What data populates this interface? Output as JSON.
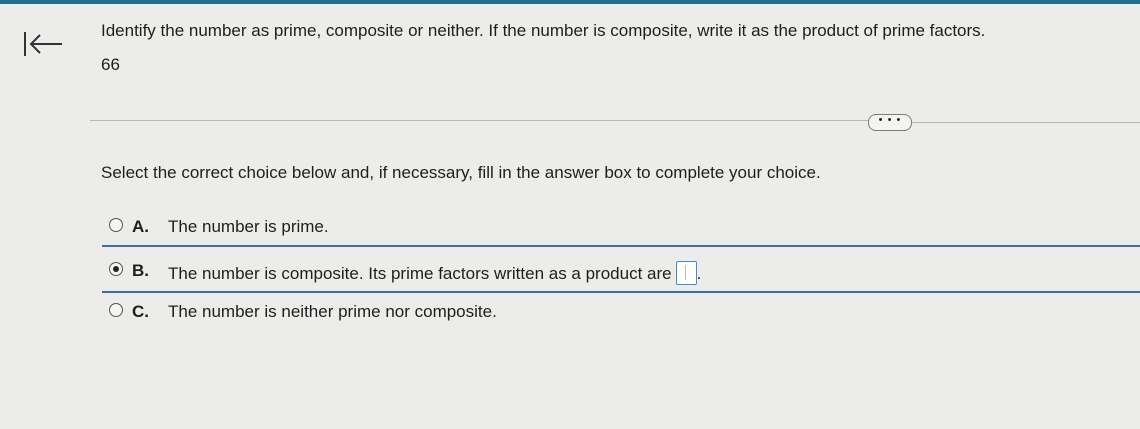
{
  "header": {
    "accent_color": "#1f6f8f",
    "back_icon": "back-to-start-icon"
  },
  "question": {
    "text": "Identify the number as prime, composite or neither. If the number is composite, write it as the product of prime factors.",
    "number": "66"
  },
  "more_button": {
    "label": "• • •"
  },
  "instruction": "Select the correct choice below and, if necessary, fill in the answer box to complete your choice.",
  "choices": [
    {
      "letter": "A.",
      "text": "The number is prime.",
      "selected": false
    },
    {
      "letter": "B.",
      "text": "The number is composite. Its prime factors written as a product are",
      "after_box": ".",
      "selected": true,
      "answer_value": ""
    },
    {
      "letter": "C.",
      "text": "The number is neither prime nor composite.",
      "selected": false
    }
  ]
}
